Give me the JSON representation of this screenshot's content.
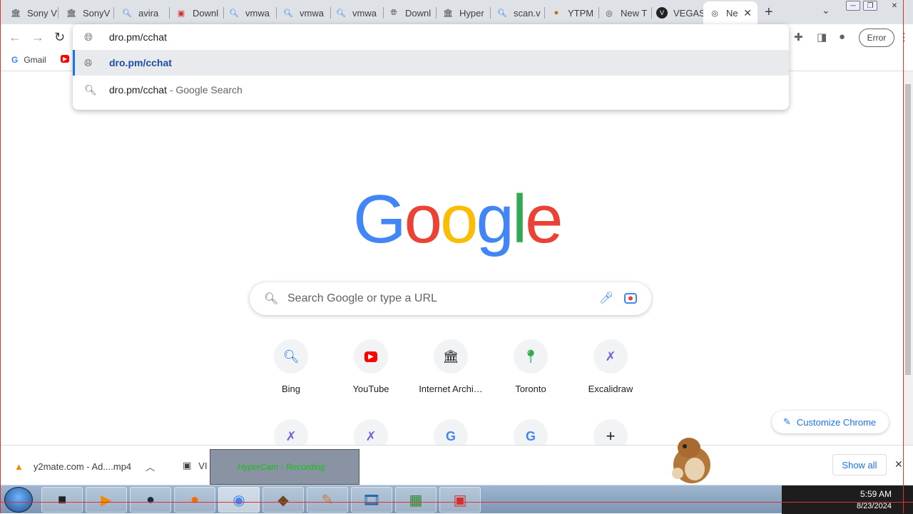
{
  "tabs": [
    {
      "title": "Sony V",
      "icon": "archive-icon"
    },
    {
      "title": "SonyV",
      "icon": "archive-icon"
    },
    {
      "title": "avira",
      "icon": "search-icon"
    },
    {
      "title": "Downl",
      "icon": "avira-icon"
    },
    {
      "title": "vmwa",
      "icon": "search-icon"
    },
    {
      "title": "vmwa",
      "icon": "search-icon"
    },
    {
      "title": "vmwa",
      "icon": "search-icon"
    },
    {
      "title": "Downl",
      "icon": "globe-icon"
    },
    {
      "title": "Hyper",
      "icon": "archive-icon"
    },
    {
      "title": "scan.v",
      "icon": "search-icon"
    },
    {
      "title": "YTPM",
      "icon": "ytpm-icon"
    },
    {
      "title": "New T",
      "icon": "chrome-icon"
    },
    {
      "title": "VEGAS",
      "icon": "vegas-icon"
    },
    {
      "title": "Ne",
      "icon": "chrome-icon",
      "active": true
    }
  ],
  "toolbar": {
    "profile_error": "Error"
  },
  "omnibox": {
    "input_value": "dro.pm/cchat",
    "suggestions": [
      {
        "text": "dro.pm/cchat",
        "suffix": "",
        "icon": "globe-icon"
      },
      {
        "text": "dro.pm/cchat",
        "suffix": " - Google Search",
        "icon": "search-icon"
      }
    ]
  },
  "bookmarks": [
    {
      "label": "Gmail",
      "icon": "google-icon"
    },
    {
      "label": "",
      "icon": "youtube-icon"
    }
  ],
  "page": {
    "logo": "Google",
    "search_placeholder": "Search Google or type a URL",
    "shortcuts": [
      {
        "label": "Bing",
        "icon": "bing-search-icon"
      },
      {
        "label": "YouTube",
        "icon": "youtube-icon"
      },
      {
        "label": "Internet Archi…",
        "icon": "archive-icon"
      },
      {
        "label": "Toronto",
        "icon": "maps-pin-icon"
      },
      {
        "label": "Excalidraw",
        "icon": "excalidraw-icon"
      }
    ],
    "shortcuts_row2": [
      {
        "icon": "excalidraw-icon"
      },
      {
        "icon": "excalidraw-icon"
      },
      {
        "icon": "google-icon"
      },
      {
        "icon": "google-icon"
      },
      {
        "icon": "add-icon"
      }
    ],
    "customize_label": "Customize Chrome"
  },
  "downloads": {
    "items": [
      {
        "name": "y2mate.com - Ad....mp4",
        "icon": "vlc-icon"
      },
      {
        "name": "VI",
        "icon": "installer-icon"
      }
    ],
    "show_all": "Show all"
  },
  "hypercam": {
    "label": "HyperCam - Recording"
  },
  "taskbar": {
    "time": "5:59 AM",
    "date": "8/23/2024"
  },
  "colors": {
    "google_blue": "#4285F4",
    "google_red": "#EA4335",
    "google_yellow": "#FBBC05",
    "google_green": "#34A853",
    "accent": "#1a73e8"
  }
}
